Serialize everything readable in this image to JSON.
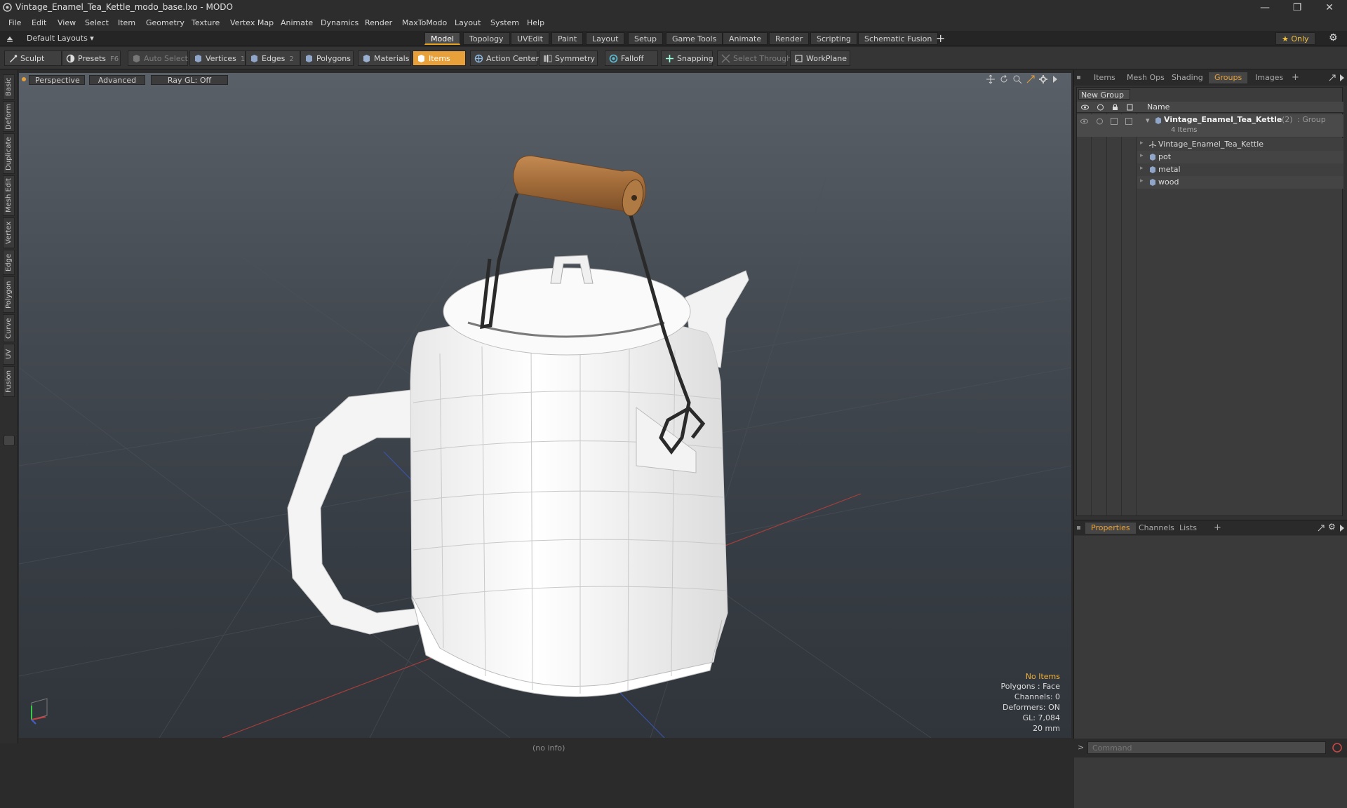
{
  "window": {
    "title": "Vintage_Enamel_Tea_Kettle_modo_base.lxo - MODO",
    "minimize": "—",
    "maximize": "❐",
    "close": "✕"
  },
  "menu": [
    "File",
    "Edit",
    "View",
    "Select",
    "Item",
    "Geometry",
    "Texture",
    "Vertex Map",
    "Animate",
    "Dynamics",
    "Render",
    "MaxToModo",
    "Layout",
    "System",
    "Help"
  ],
  "layout_bar": {
    "layouts_label": "Default Layouts ▾",
    "tabs": [
      "Model",
      "Topology",
      "UVEdit",
      "Paint",
      "Layout",
      "Setup",
      "Game Tools",
      "Animate",
      "Render",
      "Scripting",
      "Schematic Fusion"
    ],
    "active_tab": "Model",
    "add": "+",
    "only_label": "★ Only",
    "gear": "⚙"
  },
  "toolbar": {
    "sculpt": "Sculpt",
    "presets": "Presets",
    "presets_key": "F6",
    "auto_select": "Auto Select",
    "vertices": "Vertices",
    "vertices_count": "1",
    "edges": "Edges",
    "edges_count": "2",
    "polygons": "Polygons",
    "materials": "Materials",
    "items": "Items",
    "action_center": "Action Center",
    "symmetry": "Symmetry",
    "falloff": "Falloff",
    "snapping": "Snapping",
    "select_through": "Select Through",
    "workplane": "WorkPlane"
  },
  "left_tabs": [
    "Basic",
    "Deform",
    "Duplicate",
    "Mesh Edit",
    "Vertex",
    "Edge",
    "Polygon",
    "Curve",
    "UV",
    "Fusion"
  ],
  "viewport": {
    "perspective": "Perspective",
    "advanced": "Advanced",
    "ray_gl": "Ray GL: Off",
    "info": {
      "no_items": "No Items",
      "polygons": "Polygons : Face",
      "channels": "Channels: 0",
      "deformers": "Deformers: ON",
      "gl": "GL: 7,084",
      "scale": "20 mm"
    },
    "colors": {
      "no_items": "#f0b23c",
      "grid_red": "#c0403a",
      "grid_blue": "#3a58c0"
    }
  },
  "right_top": {
    "tabs": [
      "Items",
      "Mesh Ops",
      "Shading",
      "Groups",
      "Images"
    ],
    "active_tab": "Groups",
    "add": "+",
    "new_group": "New Group",
    "name_header": "Name",
    "group": {
      "name": "Vintage_Enamel_Tea_Kettle",
      "count": "(2)",
      "type": ": Group",
      "items_count": "4 Items"
    },
    "items": [
      "Vintage_Enamel_Tea_Kettle",
      "pot",
      "metal",
      "wood"
    ]
  },
  "right_bottom": {
    "tabs": [
      "Properties",
      "Channels",
      "Lists"
    ],
    "active_tab": "Properties",
    "add": "+"
  },
  "status": {
    "info": "(no info)",
    "command_prompt": ">",
    "command_placeholder": "Command"
  }
}
